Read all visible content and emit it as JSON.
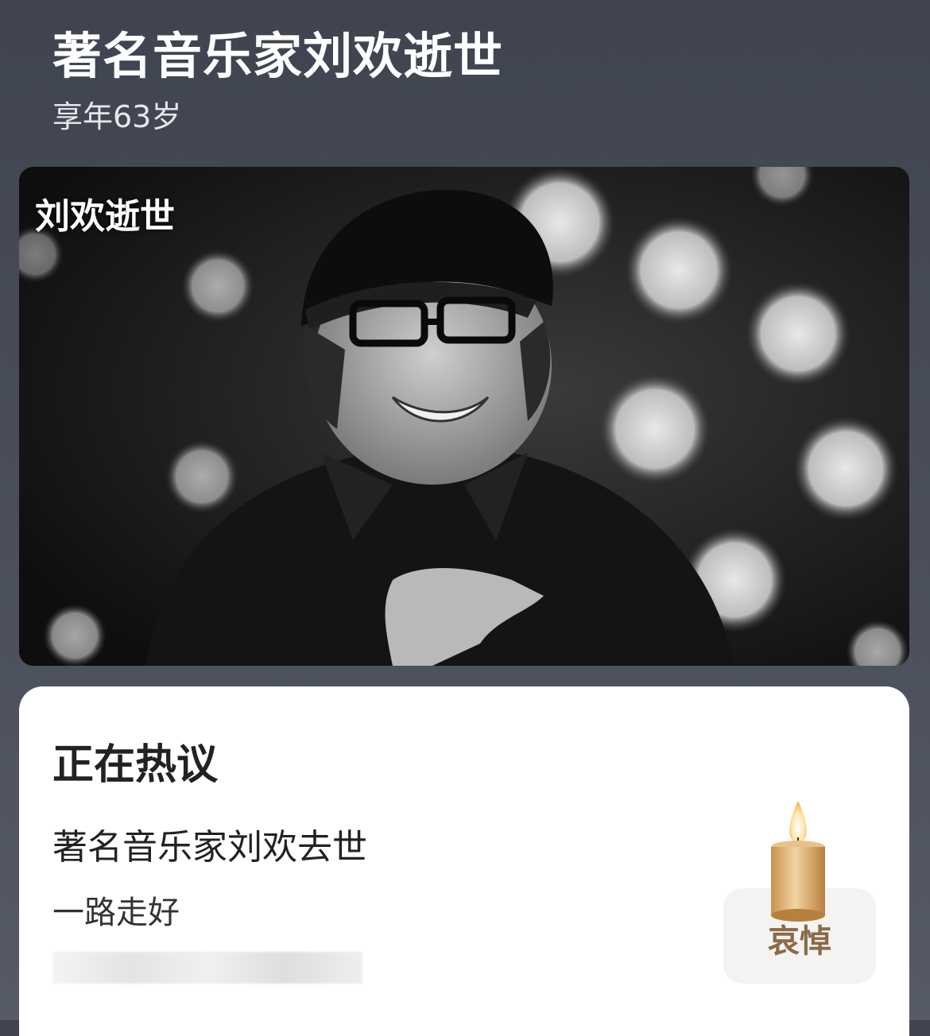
{
  "header": {
    "title": "著名音乐家刘欢逝世",
    "subtitle": "享年63岁"
  },
  "photo": {
    "caption": "刘欢逝世"
  },
  "card": {
    "heading": "正在热议",
    "line1": "著名音乐家刘欢去世",
    "line2": "一路走好",
    "mourn_button": "哀悼"
  },
  "colors": {
    "mourn_text": "#8a6a48",
    "background_top": "#3f4450",
    "candle_body": "#d9a968"
  }
}
